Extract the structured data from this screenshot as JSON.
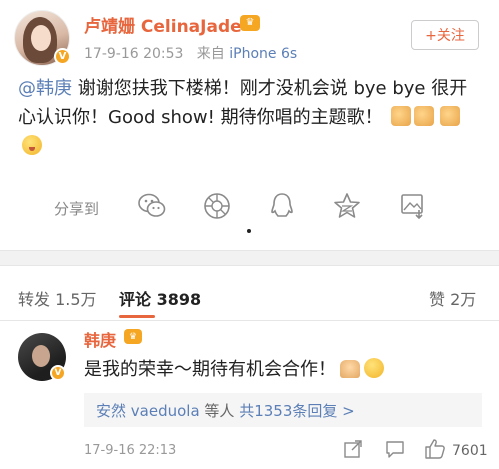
{
  "post": {
    "username": "卢靖姗 CelinaJade",
    "timestamp": "17-9-16 20:53",
    "source_prefix": "来自",
    "device": "iPhone 6s",
    "follow_label": "+关注",
    "mention": "@韩庚",
    "text": " 谢谢您扶我下楼梯！刚才没机会说 bye bye 很开心认识你！Good show! 期待你唱的主题歌！"
  },
  "share": {
    "label": "分享到",
    "targets": [
      "wechat-icon",
      "moments-icon",
      "qq-icon",
      "qzone-icon",
      "save-image-icon"
    ]
  },
  "tabs": {
    "repost": "转发 1.5万",
    "comments": "评论 3898",
    "likes": "赞 2万"
  },
  "comment": {
    "username": "韩庚",
    "text": "是我的荣幸～期待有机会合作！",
    "reply_users": "安然 vaeduola",
    "reply_mid": " 等人 ",
    "reply_count": "共1353条回复 >",
    "timestamp": "17-9-16 22:13",
    "likes": "7601"
  },
  "colors": {
    "accent_orange": "#e8663d",
    "link_blue": "#5b7fb6",
    "badge_gold": "#f5a623"
  }
}
